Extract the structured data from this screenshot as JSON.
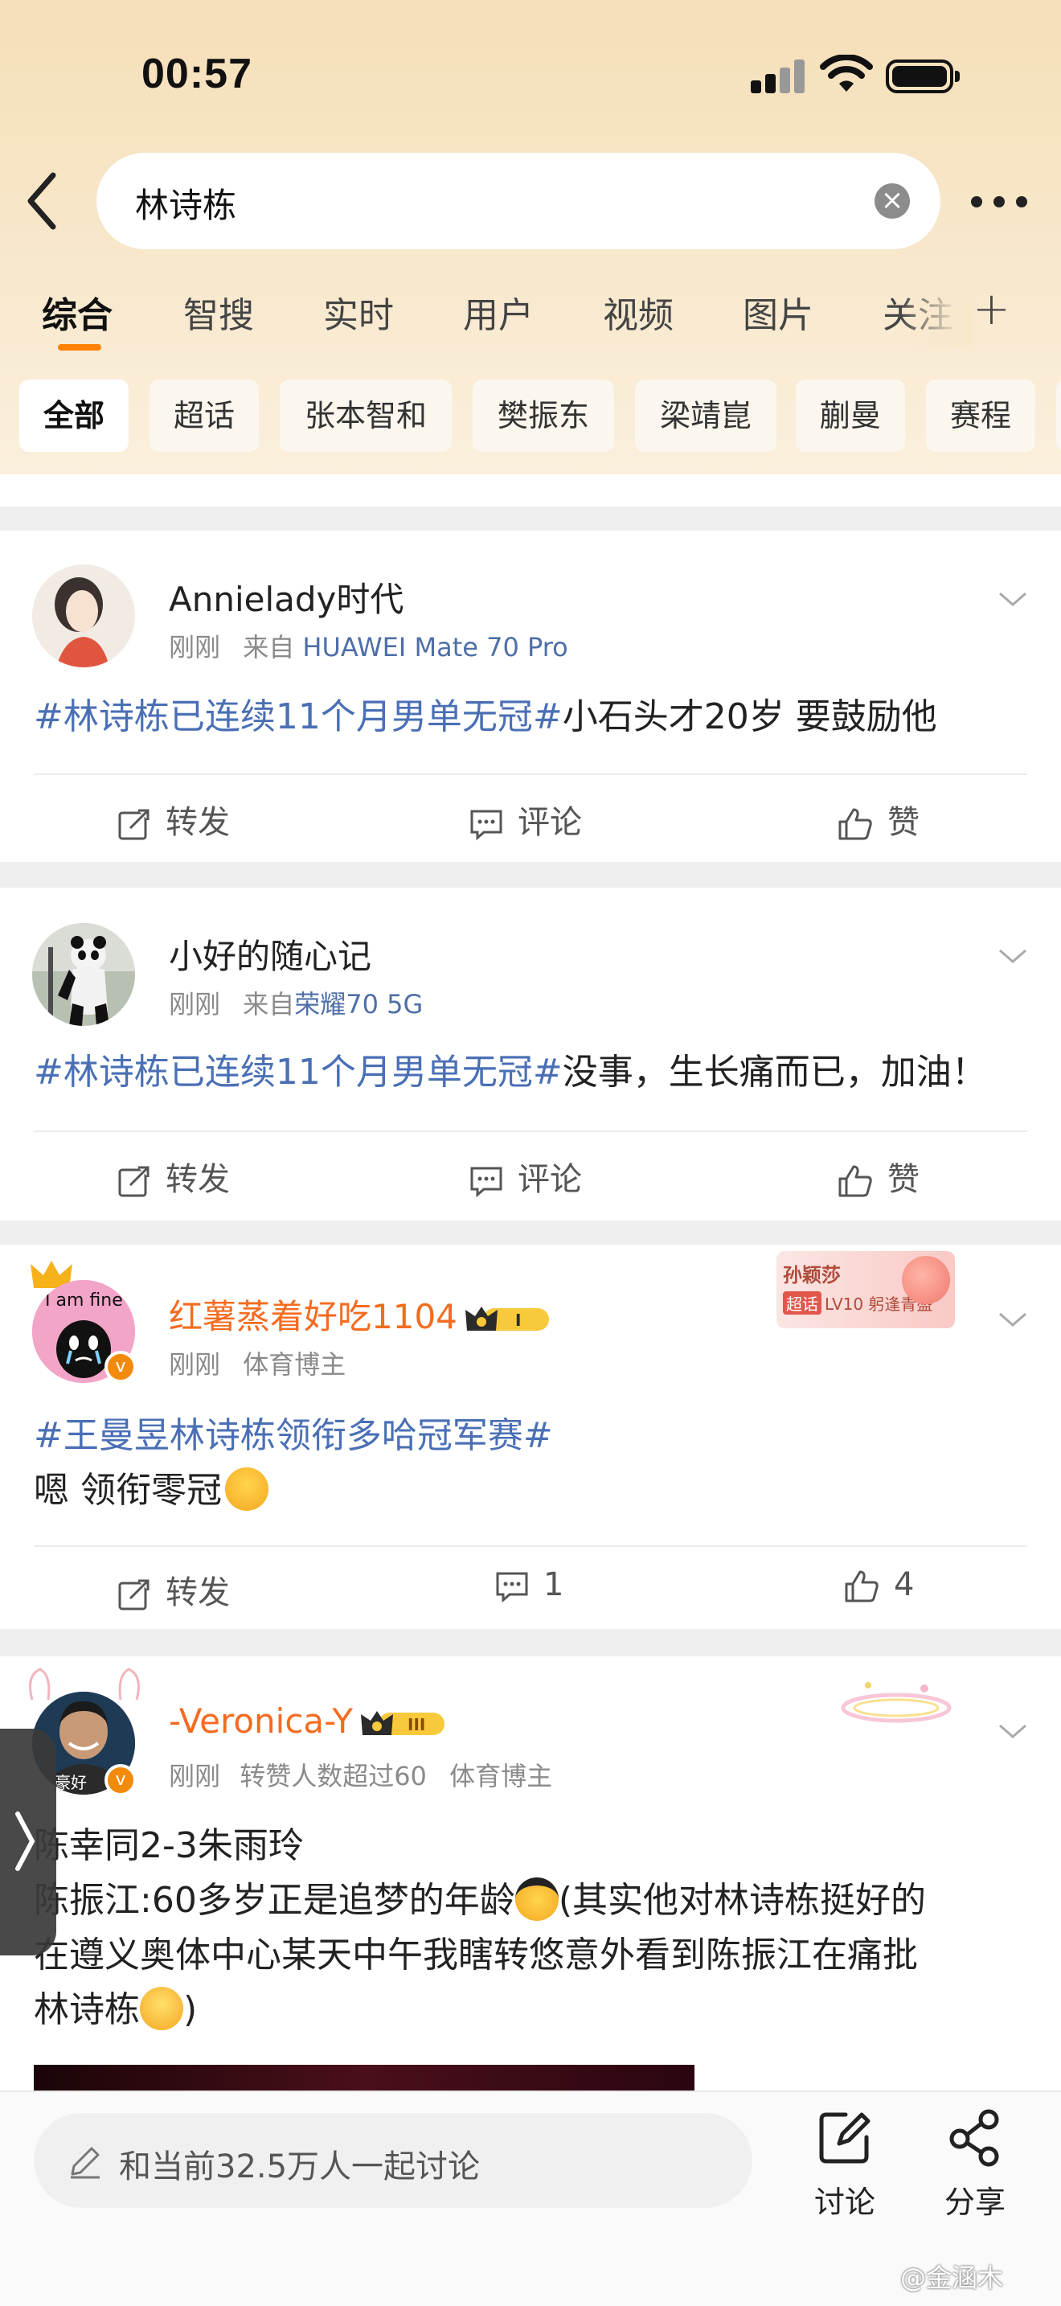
{
  "status_bar": {
    "time": "00:57"
  },
  "search": {
    "query": "林诗栋"
  },
  "tabs": [
    {
      "label": "综合"
    },
    {
      "label": "智搜"
    },
    {
      "label": "实时"
    },
    {
      "label": "用户"
    },
    {
      "label": "视频"
    },
    {
      "label": "图片"
    },
    {
      "label": "关注"
    }
  ],
  "chips": [
    {
      "label": "全部"
    },
    {
      "label": "超话"
    },
    {
      "label": "张本智和"
    },
    {
      "label": "樊振东"
    },
    {
      "label": "梁靖崑"
    },
    {
      "label": "蒯曼"
    },
    {
      "label": "赛程"
    }
  ],
  "posts": [
    {
      "username": "Annielady时代",
      "time": "刚刚",
      "source_prefix": "来自",
      "source": "HUAWEI Mate 70 Pro",
      "topic": "#林诗栋已连续11个月男单无冠#",
      "text": "小石头才20岁 要鼓励他",
      "repost": "转发",
      "comment": "评论",
      "like": "赞"
    },
    {
      "username": "小好的随心记",
      "time": "刚刚",
      "source_prefix": "来自",
      "source": "荣耀70 5G",
      "topic": "#林诗栋已连续11个月男单无冠#",
      "text": "没事，生长痛而已，加油！",
      "repost": "转发",
      "comment": "评论",
      "like": "赞"
    },
    {
      "username": "红薯蒸着好吃1104",
      "time": "刚刚",
      "role": "体育博主",
      "vip_level": "I",
      "fan_card": {
        "name": "孙颖莎",
        "tag": "超话",
        "level": "LV10 躬逢青盛"
      },
      "avatar_text": "I am fine",
      "topic": "#王曼昱林诗栋领衔多哈冠军赛#",
      "text": "嗯 领衔零冠",
      "repost": "转发",
      "comment": "1",
      "like": "4"
    },
    {
      "username": "-Veronica-Y",
      "time": "刚刚",
      "extra": "转赞人数超过60",
      "role": "体育博主",
      "vip_level": "III",
      "avatar_text": "豪好",
      "line1": "陈幸同2-3朱雨玲",
      "line2": "陈振江:60多岁正是追梦的年龄",
      "line2_rest": "(其实他对林诗栋挺好的",
      "line3": "在遵义奥体中心某天中午我瞎转悠意外看到陈振江在痛批",
      "line4": "林诗栋",
      "line4_rest": ")"
    }
  ],
  "bottom_bar": {
    "placeholder": "和当前32.5万人一起讨论",
    "discuss_label": "讨论",
    "share_label": "分享"
  },
  "watermark": "@金涵木",
  "colors": {
    "accent": "#ff8200",
    "topic": "#4a6fb5",
    "vip_name": "#f56b1f"
  }
}
